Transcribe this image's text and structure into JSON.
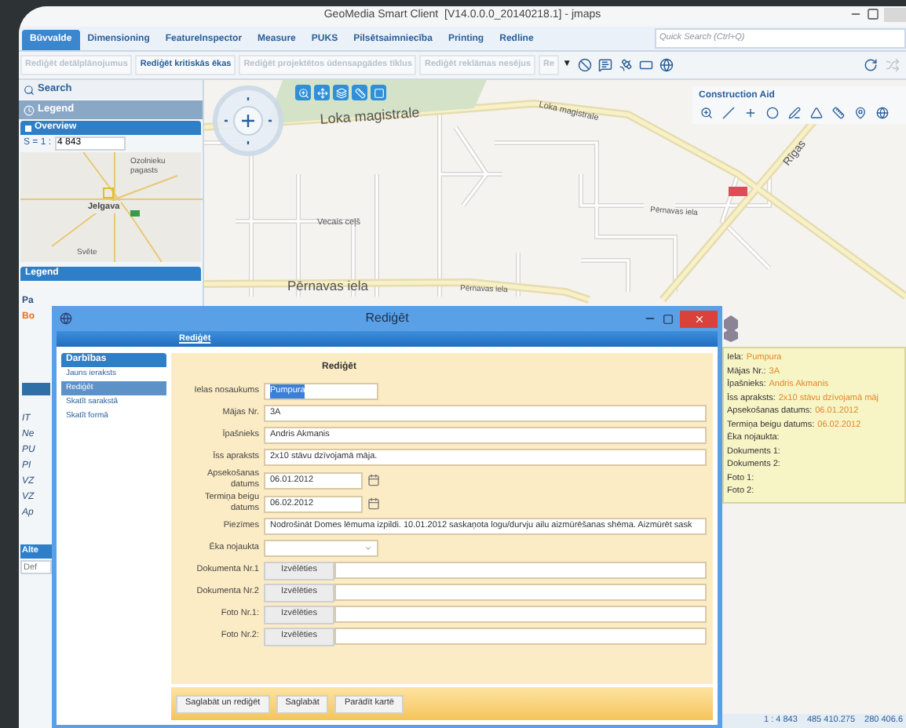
{
  "window": {
    "title": "GeoMedia Smart Client  [V14.0.0.0_20140218.1] - jmaps"
  },
  "ribbon_tabs": [
    {
      "label": "Būvvalde",
      "selected": true
    },
    {
      "label": "Dimensioning",
      "selected": false
    },
    {
      "label": "FeatureInspector",
      "selected": false
    },
    {
      "label": "Measure",
      "selected": false
    },
    {
      "label": "PUKS",
      "selected": false
    },
    {
      "label": "Pilsētsaimniecība",
      "selected": false
    },
    {
      "label": "Printing",
      "selected": false
    },
    {
      "label": "Redline",
      "selected": false
    }
  ],
  "quick_search": {
    "placeholder": "Quick Search (Ctrl+Q)"
  },
  "commands": [
    {
      "label": "Rediģēt detālplānojumus",
      "disabled": true
    },
    {
      "label": "Rediģēt kritiskās ēkas",
      "disabled": false
    },
    {
      "label": "Rediģēt projektētos ūdensapgādes tīklus",
      "disabled": true
    },
    {
      "label": "Rediģēt reklāmas nesējus",
      "disabled": true
    },
    {
      "label": "Re",
      "disabled": true
    }
  ],
  "commands_overflow": "▼",
  "left_panel": {
    "search": "Search",
    "legend_tab": "Legend",
    "overview": {
      "title": "Overview",
      "scale_label": "S = 1 :",
      "scale_value": "4 843",
      "labels": [
        "Ozolnieku pagasts",
        "Jelgava",
        "Svēte"
      ]
    },
    "legend": {
      "title": "Legend",
      "items": [
        {
          "label": "Pa",
          "highlighted": false
        },
        {
          "label": "Bo",
          "highlighted": true
        }
      ],
      "sub_items": [
        "IT",
        "Ne",
        "PU",
        "PI",
        "VZ",
        "VZ",
        "Ap"
      ]
    },
    "bottom_header": "Alte",
    "bottom_field": "Def"
  },
  "map": {
    "street_labels": [
      "Loka magistrale",
      "Loka magistrale",
      "Rīgas",
      "Vecais ceļš",
      "Pērnavas iela",
      "Pērnavas iela",
      "Pērnavas iela"
    ],
    "construction_aid": {
      "title": "Construction Aid"
    }
  },
  "info_popup": [
    {
      "label": "Iela:",
      "value": "Pumpura"
    },
    {
      "label": "Mājas Nr.:",
      "value": "3A"
    },
    {
      "label": "Īpašnieks:",
      "value": "Andris Akmanis"
    },
    {
      "label": "Īss apraksts:",
      "value": "2x10 stāvu dzīvojamā māj"
    },
    {
      "label": "Apsekošanas datums:",
      "value": "06.01.2012"
    },
    {
      "label": "Termiņa beigu datums:",
      "value": "06.02.2012"
    },
    {
      "label": "Ēka nojaukta:"
    },
    {
      "label": "Dokuments 1:"
    },
    {
      "label": "Dokuments 2:"
    },
    {
      "label": "Foto 1:"
    },
    {
      "label": "Foto 2:"
    }
  ],
  "status_bar": [
    "1 : 4 843",
    "485 410.275",
    "280 406.6"
  ],
  "dialog": {
    "title": "Rediģēt",
    "header": "Rediģēt",
    "actions_title": "Darbības",
    "actions": [
      {
        "label": "Jauns ieraksts",
        "selected": false
      },
      {
        "label": "Rediģēt",
        "selected": true
      },
      {
        "label": "Skatīt sarakstā",
        "selected": false
      },
      {
        "label": "Skatīt formā",
        "selected": false
      }
    ],
    "form_title": "Rediģēt",
    "fields": [
      {
        "kind": "short",
        "label": "Ielas nosaukums",
        "value": "Pumpura",
        "highlighted": true
      },
      {
        "kind": "text",
        "label": "Mājas Nr.",
        "value": "3A",
        "highlighted": false
      },
      {
        "kind": "text",
        "label": "Īpašnieks",
        "value": "Andris Akmanis",
        "highlighted": false
      },
      {
        "kind": "text",
        "label": "Īss apraksts",
        "value": "2x10 stāvu dzīvojamā māja.",
        "highlighted": false
      },
      {
        "kind": "date",
        "label": "Apsekošanas datums",
        "value": "06.01.2012",
        "highlighted": false
      },
      {
        "kind": "date",
        "label": "Termiņa beigu datums",
        "value": "06.02.2012",
        "highlighted": false
      },
      {
        "kind": "text",
        "label": "Piezīmes",
        "value": "Nodrošināt Domes lēmuma izpildi. 10.01.2012 saskaņota logu/durvju ailu aizmūrēšanas shēma. Aizmūrēt sask",
        "highlighted": false
      },
      {
        "kind": "select",
        "label": "Ēka nojaukta"
      },
      {
        "kind": "file",
        "label": "Dokumenta Nr.1",
        "button": "Izvēlēties"
      },
      {
        "kind": "file",
        "label": "Dokumenta Nr.2",
        "button": "Izvēlēties"
      },
      {
        "kind": "file",
        "label": "Foto Nr.1:",
        "button": "Izvēlēties"
      },
      {
        "kind": "file",
        "label": "Foto Nr.2:",
        "button": "Izvēlēties"
      }
    ],
    "buttons": [
      "Saglabāt un rediģēt",
      "Saglabāt",
      "Parādīt kartē"
    ]
  }
}
